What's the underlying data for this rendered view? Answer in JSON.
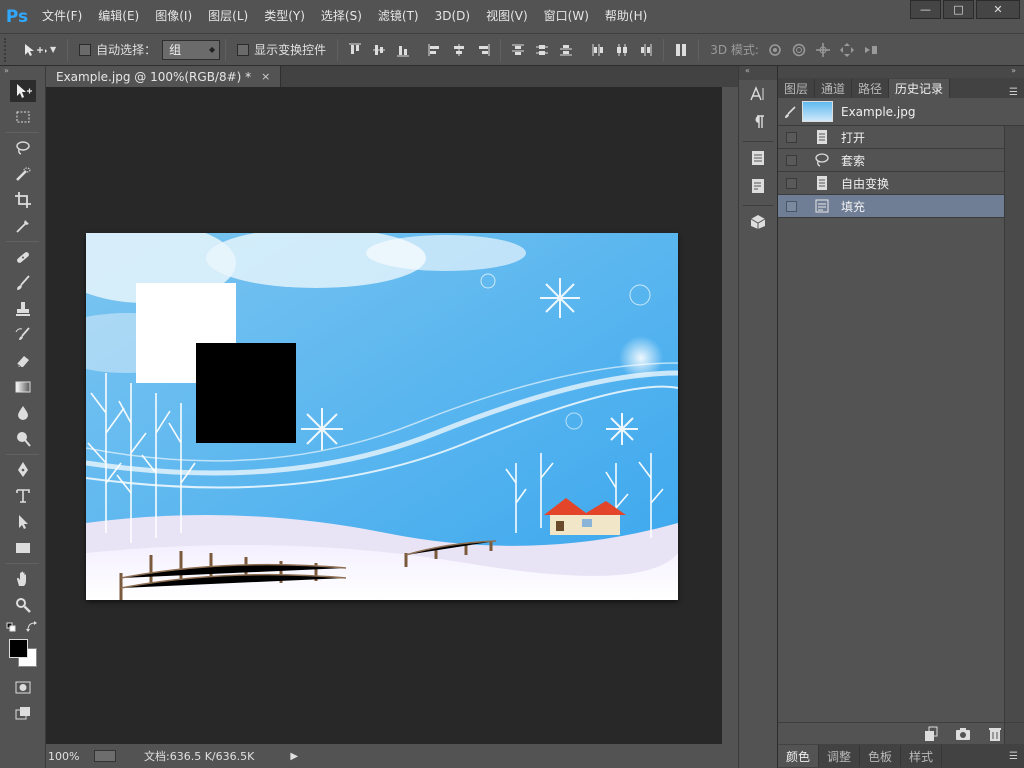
{
  "app": {
    "logo": "Ps",
    "menus": [
      "文件(F)",
      "编辑(E)",
      "图像(I)",
      "图层(L)",
      "类型(Y)",
      "选择(S)",
      "滤镜(T)",
      "3D(D)",
      "视图(V)",
      "窗口(W)",
      "帮助(H)"
    ],
    "window_controls": {
      "minimize": "—",
      "maximize": "□",
      "close": "✕"
    }
  },
  "options_bar": {
    "auto_select_label": "自动选择：",
    "auto_select_value": "组",
    "show_transform_label": "显示变换控件",
    "mode_3d_label": "3D 模式:"
  },
  "tools": [
    {
      "name": "move-tool",
      "icon": "move-icon",
      "active": true
    },
    {
      "name": "marquee-tool",
      "icon": "rect-marquee-icon"
    },
    {
      "name": "lasso-tool",
      "icon": "lasso-icon"
    },
    {
      "name": "quick-select-tool",
      "icon": "quick-select-icon"
    },
    {
      "name": "crop-tool",
      "icon": "crop-icon"
    },
    {
      "name": "eyedropper-tool",
      "icon": "eyedropper-icon"
    },
    {
      "name": "healing-tool",
      "icon": "bandage-icon"
    },
    {
      "name": "brush-tool",
      "icon": "brush-icon"
    },
    {
      "name": "stamp-tool",
      "icon": "stamp-icon"
    },
    {
      "name": "history-brush-tool",
      "icon": "history-brush-icon"
    },
    {
      "name": "eraser-tool",
      "icon": "eraser-icon"
    },
    {
      "name": "gradient-tool",
      "icon": "gradient-icon"
    },
    {
      "name": "blur-tool",
      "icon": "blur-drop-icon"
    },
    {
      "name": "dodge-tool",
      "icon": "dodge-icon"
    },
    {
      "name": "pen-tool",
      "icon": "pen-icon"
    },
    {
      "name": "type-tool",
      "icon": "type-icon"
    },
    {
      "name": "path-select-tool",
      "icon": "path-select-icon"
    },
    {
      "name": "shape-tool",
      "icon": "rectangle-icon"
    },
    {
      "name": "hand-tool",
      "icon": "hand-icon"
    },
    {
      "name": "zoom-tool",
      "icon": "zoom-icon"
    }
  ],
  "document": {
    "tab_title": "Example.jpg @ 100%(RGB/8#) *",
    "tab_close": "×",
    "status_zoom": "100%",
    "status_doc": "文档:636.5 K/636.5K",
    "status_arrow": "▶"
  },
  "right_panel": {
    "tabs": [
      "图层",
      "通道",
      "路径",
      "历史记录"
    ],
    "active_tab": "历史记录",
    "snapshot_name": "Example.jpg",
    "history": [
      {
        "label": "打开",
        "icon": "document-icon"
      },
      {
        "label": "套索",
        "icon": "lasso-icon"
      },
      {
        "label": "自由变换",
        "icon": "document-icon"
      },
      {
        "label": "填充",
        "icon": "fill-icon",
        "selected": true
      }
    ],
    "bottom_tabs": [
      "颜色",
      "调整",
      "色板",
      "样式"
    ],
    "active_bottom_tab": "颜色"
  },
  "colors": {
    "foreground": "#000000",
    "background": "#ffffff",
    "panel_bg": "#535353",
    "canvas_bg": "#282828",
    "selected_row": "#6f7e95"
  }
}
